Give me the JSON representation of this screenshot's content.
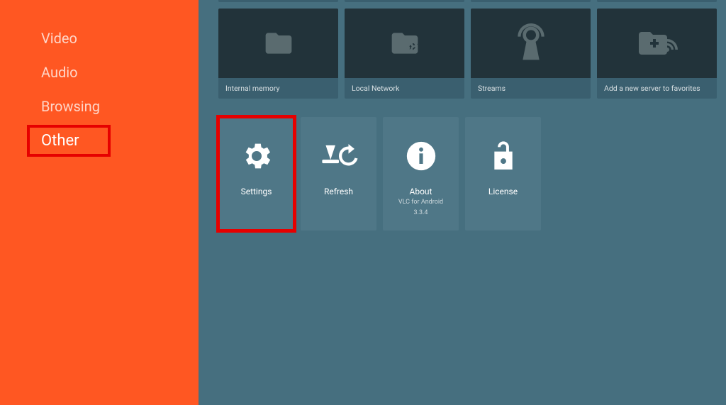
{
  "sidebar": {
    "items": [
      {
        "label": "Video",
        "active": false
      },
      {
        "label": "Audio",
        "active": false
      },
      {
        "label": "Browsing",
        "active": false
      },
      {
        "label": "Other",
        "active": true
      }
    ]
  },
  "browse_row": {
    "items": [
      {
        "label": "Internal memory",
        "icon": "folder"
      },
      {
        "label": "Local Network",
        "icon": "folder-network"
      },
      {
        "label": "Streams",
        "icon": "stream"
      },
      {
        "label": "Add a new server to favorites",
        "icon": "add-server"
      }
    ]
  },
  "other_row": {
    "items": [
      {
        "title": "Settings",
        "icon": "gear"
      },
      {
        "title": "Refresh",
        "icon": "refresh"
      },
      {
        "title": "About",
        "icon": "info",
        "sub1": "VLC for Android",
        "sub2": "3.3.4"
      },
      {
        "title": "License",
        "icon": "unlock"
      }
    ]
  }
}
